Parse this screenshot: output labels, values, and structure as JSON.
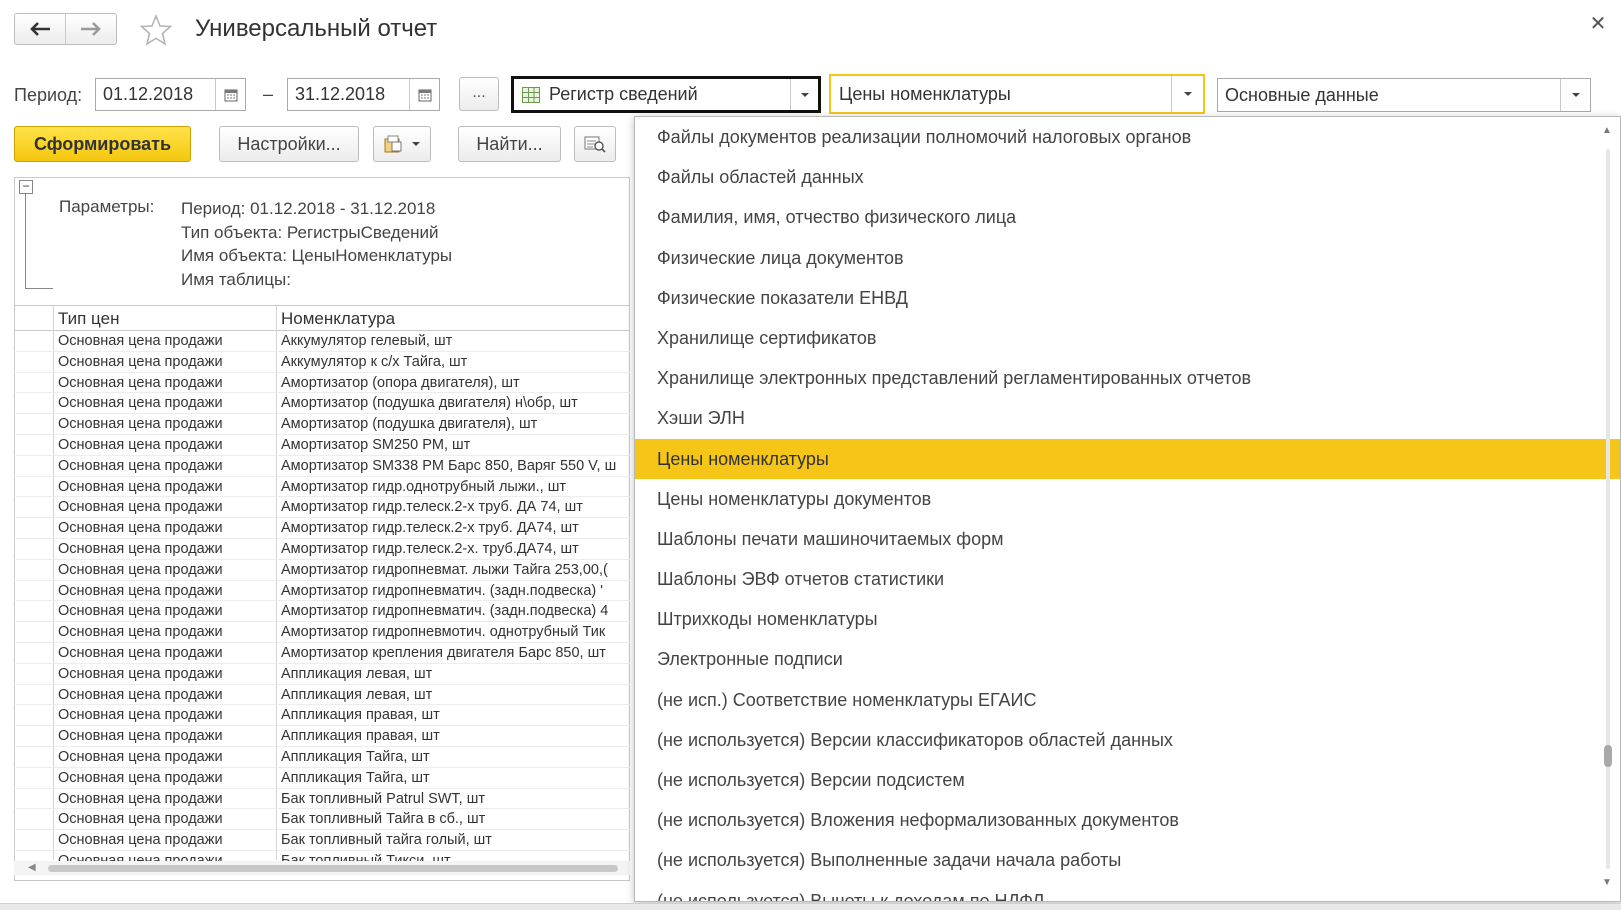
{
  "window": {
    "title": "Универсальный отчет"
  },
  "period": {
    "label": "Период:",
    "from": "01.12.2018",
    "dash": "–",
    "to": "31.12.2018",
    "more_label": "..."
  },
  "selectors": {
    "object_type": "Регистр сведений",
    "object_name": "Цены номенклатуры",
    "table": "Основные данные"
  },
  "toolbar": {
    "generate_label": "Сформировать",
    "settings_label": "Настройки...",
    "find_label": "Найти..."
  },
  "params": {
    "label": "Параметры:",
    "lines": [
      "Период: 01.12.2018 - 31.12.2018",
      "Тип объекта: РегистрыСведений",
      "Имя объекта: ЦеныНоменклатуры",
      "Имя таблицы:"
    ]
  },
  "table": {
    "headers": [
      "Тип цен",
      "Номенклатура"
    ],
    "rows": [
      [
        "Основная цена продажи",
        "Аккумулятор гелевый, шт"
      ],
      [
        "Основная цена продажи",
        "Аккумулятор к с/х Тайга, шт"
      ],
      [
        "Основная цена продажи",
        "Амортизатор (опора двигателя), шт"
      ],
      [
        "Основная цена продажи",
        "Амортизатор (подушка двигателя) н\\обр, шт"
      ],
      [
        "Основная цена продажи",
        "Амортизатор (подушка двигателя), шт"
      ],
      [
        "Основная цена продажи",
        "Амортизатор SM250 PM, шт"
      ],
      [
        "Основная цена продажи",
        "Амортизатор SM338 PM Барс 850, Варяг 550 V, ш"
      ],
      [
        "Основная цена продажи",
        "Амортизатор гидр.однотрубный лыжи., шт"
      ],
      [
        "Основная цена продажи",
        "Амортизатор гидр.телеск.2-х труб. ДА 74, шт"
      ],
      [
        "Основная цена продажи",
        "Амортизатор гидр.телеск.2-х труб. ДА74, шт"
      ],
      [
        "Основная цена продажи",
        "Амортизатор гидр.телеск.2-х. труб.ДА74, шт"
      ],
      [
        "Основная цена продажи",
        "Амортизатор гидропневмат. лыжи Тайга 253,00,("
      ],
      [
        "Основная цена продажи",
        "Амортизатор гидропневматич. (задн.подвеска) '"
      ],
      [
        "Основная цена продажи",
        "Амортизатор гидропневматич. (задн.подвеска) 4"
      ],
      [
        "Основная цена продажи",
        "Амортизатор гидропневмотич. однотрубный Тик"
      ],
      [
        "Основная цена продажи",
        "Амортизатор крепления двигателя Барс 850, шт"
      ],
      [
        "Основная цена продажи",
        "Аппликация левая, шт"
      ],
      [
        "Основная цена продажи",
        "Аппликация левая, шт"
      ],
      [
        "Основная цена продажи",
        "Аппликация правая, шт"
      ],
      [
        "Основная цена продажи",
        "Аппликация правая, шт"
      ],
      [
        "Основная цена продажи",
        "Аппликация Тайга, шт"
      ],
      [
        "Основная цена продажи",
        "Аппликация Тайга, шт"
      ],
      [
        "Основная цена продажи",
        "Бак топливный Patrul SWT, шт"
      ],
      [
        "Основная цена продажи",
        "Бак топливный Тайга в сб., шт"
      ],
      [
        "Основная цена продажи",
        "Бак топливный тайга голый, шт"
      ],
      [
        "Основная цена продажи",
        "Бак топливный Тикси, шт"
      ]
    ]
  },
  "dropdown": {
    "items": [
      "Файлы документов реализации полномочий налоговых органов",
      "Файлы областей данных",
      "Фамилия, имя, отчество физического лица",
      "Физические лица документов",
      "Физические показатели ЕНВД",
      "Хранилище сертификатов",
      "Хранилище электронных представлений регламентированных отчетов",
      "Хэши ЭЛН",
      "Цены номенклатуры",
      "Цены номенклатуры документов",
      "Шаблоны печати машиночитаемых форм",
      "Шаблоны ЭВФ отчетов статистики",
      "Штрихкоды номенклатуры",
      "Электронные подписи",
      "(не исп.) Соответствие номенклатуры ЕГАИС",
      "(не используется) Версии классификаторов областей данных",
      "(не используется) Версии подсистем",
      "(не используется) Вложения неформализованных документов",
      "(не используется) Выполненные задачи начала работы",
      "(не используется) Вычеты к доходам по НДФЛ"
    ],
    "selected_index": 8
  },
  "colors": {
    "accent": "#f5c518",
    "selected_item": "#f5c518",
    "primary_button": "#f4c70e"
  }
}
